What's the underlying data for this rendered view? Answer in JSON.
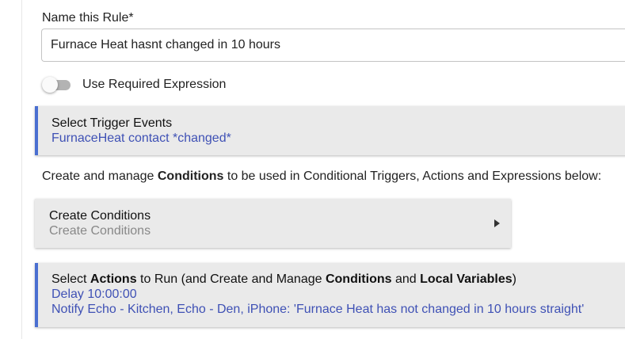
{
  "name_rule": {
    "label": "Name this Rule*",
    "value": "Furnace Heat hasnt changed in 10 hours"
  },
  "required_expression": {
    "label": "Use Required Expression",
    "enabled": false
  },
  "trigger": {
    "title": "Select Trigger Events",
    "summary": "FurnaceHeat contact *changed*"
  },
  "conditions_info": {
    "part1": "Create and manage ",
    "bold": "Conditions",
    "part2": " to be used in Conditional Triggers, Actions and Expressions below:"
  },
  "conditions": {
    "title": "Create Conditions",
    "subtitle": "Create Conditions"
  },
  "actions": {
    "title_part1": "Select ",
    "title_bold1": "Actions",
    "title_part2": " to Run (and Create and Manage ",
    "title_bold2": "Conditions",
    "title_part3": " and ",
    "title_bold3": "Local Variables",
    "title_part4": ")",
    "lines": [
      "Delay 10:00:00",
      "Notify Echo - Kitchen, Echo - Den, iPhone: 'Furnace Heat has not changed in 10 hours straight'"
    ]
  },
  "colors": {
    "accent": "#4a6fd1",
    "link_text": "#3f51b5",
    "card_bg": "#eaeaea"
  },
  "icons": {
    "conditions_expand": "caret-right-icon"
  }
}
